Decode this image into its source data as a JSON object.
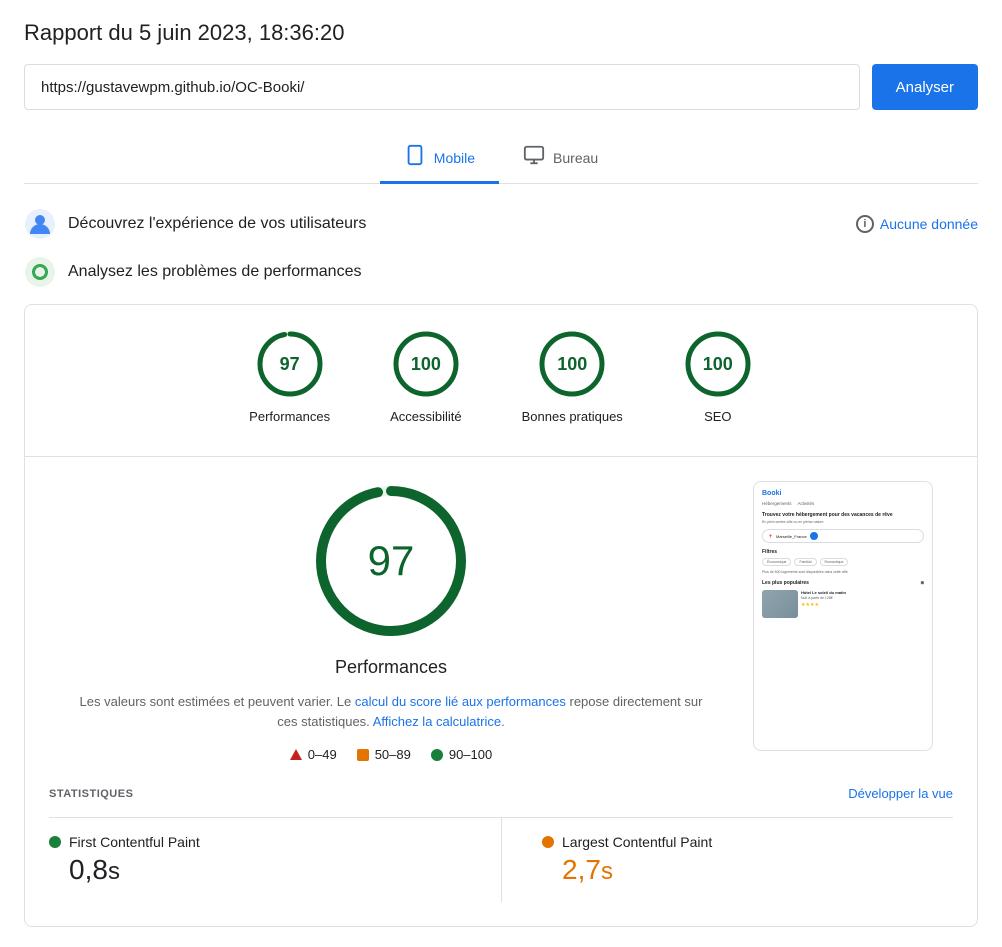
{
  "report": {
    "title": "Rapport du 5 juin 2023, 18:36:20",
    "url": "https://gustavewpm.github.io/OC-Booki/",
    "analyze_btn": "Analyser"
  },
  "tabs": [
    {
      "id": "mobile",
      "label": "Mobile",
      "active": true
    },
    {
      "id": "bureau",
      "label": "Bureau",
      "active": false
    }
  ],
  "user_exp": {
    "title": "Découvrez l'expérience de vos utilisateurs",
    "no_data": "Aucune donnée"
  },
  "perf_section": {
    "title": "Analysez les problèmes de performances"
  },
  "scores": [
    {
      "id": "performances",
      "value": 97,
      "label": "Performances",
      "color": "green"
    },
    {
      "id": "accessibilite",
      "value": 100,
      "label": "Accessibilité",
      "color": "green"
    },
    {
      "id": "bonnes-pratiques",
      "value": 100,
      "label": "Bonnes pratiques",
      "color": "green"
    },
    {
      "id": "seo",
      "value": 100,
      "label": "SEO",
      "color": "green"
    }
  ],
  "perf_detail": {
    "big_score": 97,
    "title": "Performances",
    "desc_part1": "Les valeurs sont estimées et peuvent varier. Le ",
    "link1_text": "calcul du score lié aux performances",
    "link1_href": "#",
    "desc_part2": " repose directement sur ces statistiques. ",
    "link2_text": "Affichez la calculatrice",
    "link2_href": "#",
    "desc_end": "."
  },
  "legend": [
    {
      "type": "triangle",
      "color": "#c5221f",
      "range": "0–49"
    },
    {
      "type": "square",
      "color": "#e37400",
      "range": "50–89"
    },
    {
      "type": "circle",
      "color": "#188038",
      "range": "90–100"
    }
  ],
  "stats": {
    "title": "STATISTIQUES",
    "expand": "Développer la vue",
    "metrics": [
      {
        "id": "fcp",
        "name": "First Contentful Paint",
        "value": "0,8",
        "unit": "s",
        "color": "green"
      },
      {
        "id": "lcp",
        "name": "Largest Contentful Paint",
        "value": "2,7",
        "unit": "s",
        "color": "orange"
      }
    ]
  },
  "booki_preview": {
    "brand": "Booki",
    "nav1": "Hébergements",
    "nav2": "Activités",
    "hero": "Trouvez votre hébergement pour des vacances de rêve",
    "sub": "En plein centre-ville ou en pleine nature",
    "search_text": "Marseille_France",
    "filter_title": "Filtres",
    "filters": [
      "Économique",
      "Familial",
      "Romantique"
    ],
    "count": "Plus de 500 logements sont disponibles dans cette ville",
    "popular_title": "Les plus populaires",
    "card_title": "Hôtel Le soleil du matin",
    "card_price": "Nuit à partir de 128€",
    "stars": "★★★★"
  }
}
